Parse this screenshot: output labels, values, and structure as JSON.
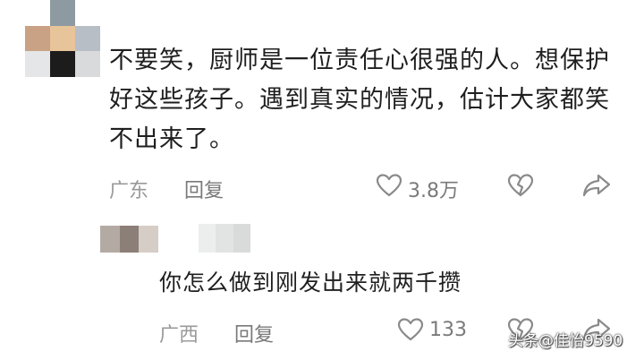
{
  "comment": {
    "text": "不要笑，厨师是一位责任心很强的人。想保护好这些孩子。遇到真实的情况，估计大家都笑不出来了。",
    "location": "广东",
    "reply_label": "回复",
    "like_count": "3.8万"
  },
  "reply": {
    "text": "你怎么做到刚发出来就两千攒",
    "location": "广西",
    "reply_label": "回复",
    "like_count": "133"
  },
  "watermark": "头条@佳怡9590",
  "colors": {
    "meta_text": "#9a9a9a",
    "body_text": "#1f1f1f",
    "icon_stroke": "#8a8a8a"
  },
  "icons": [
    "heart-icon",
    "broken-heart-icon",
    "share-arrow-icon"
  ]
}
